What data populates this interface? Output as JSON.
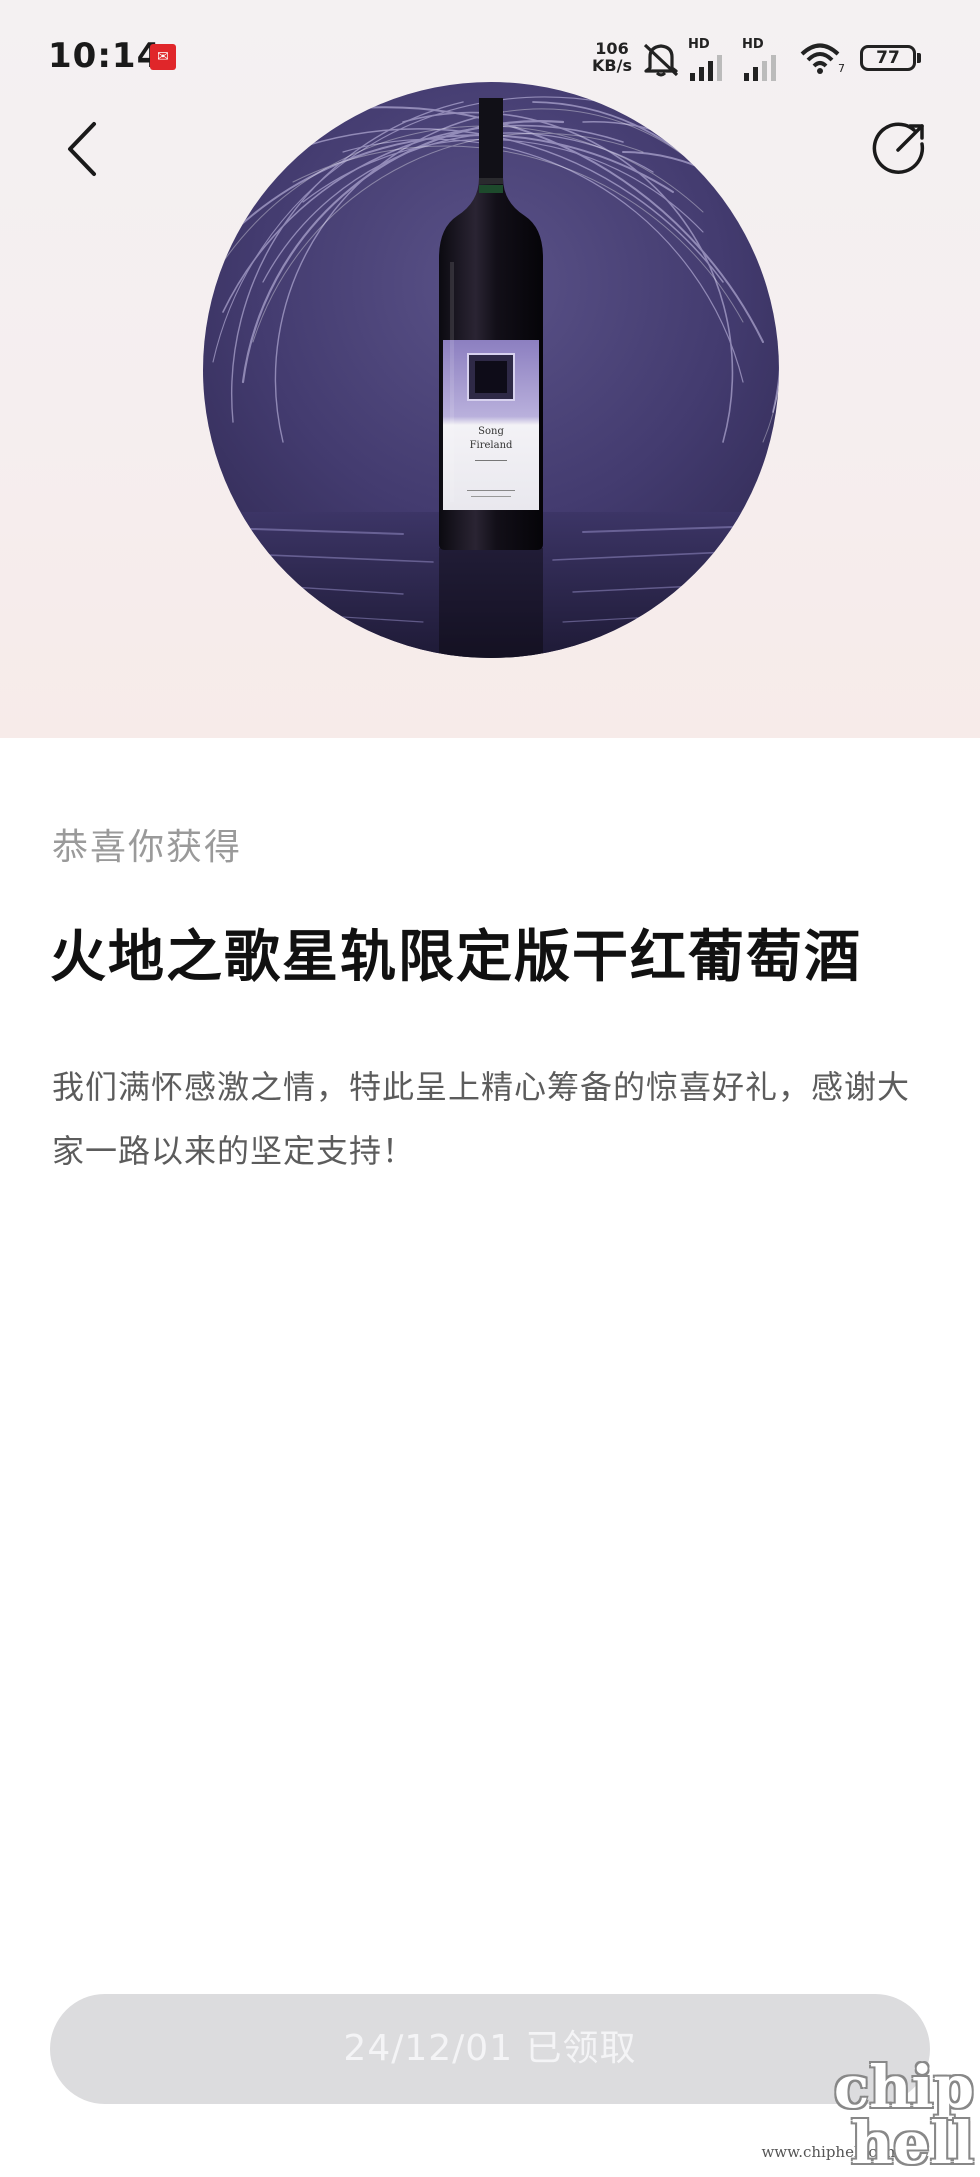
{
  "status_bar": {
    "time": "10:14",
    "net_speed_value": "106",
    "net_speed_unit": "KB/s",
    "signal_1_label": "HD",
    "signal_2_label": "HD",
    "wifi_label": "7",
    "battery": "77"
  },
  "product": {
    "label_line1": "Song",
    "label_line2": "Fireland"
  },
  "content": {
    "subtitle": "恭喜你获得",
    "title": "火地之歌星轨限定版干红葡萄酒",
    "description": "我们满怀感激之情，特此呈上精心筹备的惊喜好礼，感谢大家一路以来的坚定支持！"
  },
  "action": {
    "claimed_label": "24/12/01 已领取"
  },
  "watermark": {
    "url": "www.chiphell.com",
    "logo_line1": "chip",
    "logo_line2": "hell"
  },
  "colors": {
    "hero_bg": "#f5eeef",
    "product_bg": "#3e3766",
    "button_bg": "#dcdcde",
    "button_text": "#f4f4f6"
  }
}
